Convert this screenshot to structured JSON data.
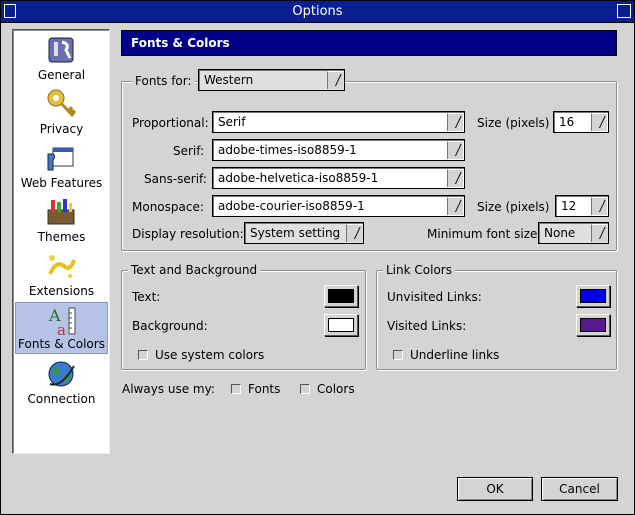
{
  "window": {
    "title": "Options"
  },
  "sidebar": {
    "items": [
      {
        "label": "General",
        "icon": "general-icon"
      },
      {
        "label": "Privacy",
        "icon": "key-icon"
      },
      {
        "label": "Web Features",
        "icon": "web-features-icon"
      },
      {
        "label": "Themes",
        "icon": "themes-icon"
      },
      {
        "label": "Extensions",
        "icon": "extensions-icon"
      },
      {
        "label": "Fonts & Colors",
        "icon": "fonts-icon",
        "selected": true
      },
      {
        "label": "Connection",
        "icon": "globe-icon"
      }
    ]
  },
  "header": {
    "title": "Fonts & Colors"
  },
  "fonts": {
    "fonts_for_label": "Fonts for:",
    "fonts_for_value": "Western",
    "proportional_label": "Proportional:",
    "proportional_value": "Serif",
    "size_label": "Size (pixels)",
    "proportional_size": "16",
    "serif_label": "Serif:",
    "serif_value": "adobe-times-iso8859-1",
    "sans_serif_label": "Sans-serif:",
    "sans_serif_value": "adobe-helvetica-iso8859-1",
    "monospace_label": "Monospace:",
    "monospace_value": "adobe-courier-iso8859-1",
    "monospace_size": "12",
    "display_resolution_label": "Display resolution:",
    "display_resolution_value": "System setting",
    "min_font_size_label": "Minimum font size:",
    "min_font_size_value": "None"
  },
  "text_background": {
    "title": "Text and Background",
    "text_label": "Text:",
    "text_color": "#000000",
    "background_label": "Background:",
    "background_color": "#ffffff",
    "use_system_colors": "Use system colors"
  },
  "link_colors": {
    "title": "Link Colors",
    "unvisited_label": "Unvisited Links:",
    "unvisited_color": "#0000ee",
    "visited_label": "Visited Links:",
    "visited_color": "#551a8b",
    "underline_links": "Underline links"
  },
  "always_use": {
    "label": "Always use my:",
    "fonts": "Fonts",
    "colors": "Colors"
  },
  "buttons": {
    "ok": "OK",
    "cancel": "Cancel"
  }
}
